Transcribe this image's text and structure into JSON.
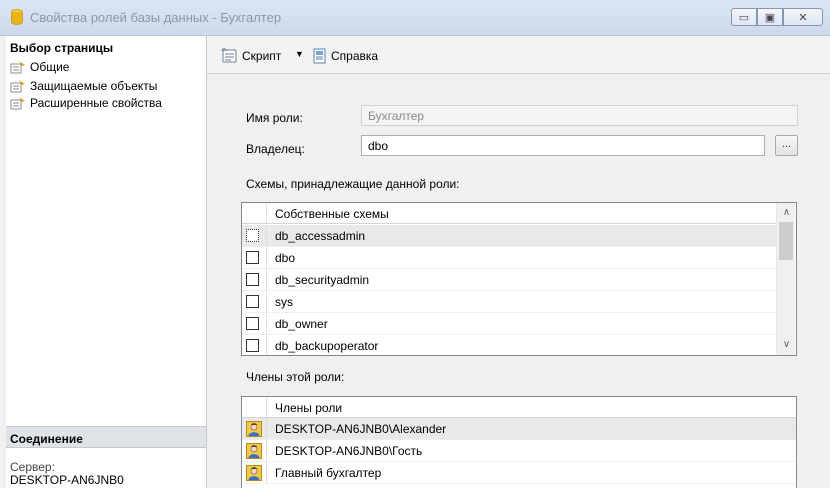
{
  "window": {
    "title": "Свойства ролей базы данных - Бухгалтер",
    "min_glyph": "▭",
    "max_glyph": "▣",
    "close_glyph": "✕"
  },
  "sidebar": {
    "heading": "Выбор страницы",
    "items": [
      {
        "label": "Общие"
      },
      {
        "label": "Защищаемые объекты"
      },
      {
        "label": "Расширенные свойства"
      }
    ],
    "connection_heading": "Соединение",
    "server_label": "Сервер:",
    "server_value": "DESKTOP-AN6JNB0"
  },
  "toolbar": {
    "script_label": "Скрипт",
    "script_arrow": "▼",
    "help_label": "Справка"
  },
  "form": {
    "role_name_label": "Имя роли:",
    "role_name_value": "Бухгалтер",
    "owner_label": "Владелец:",
    "owner_value": "dbo",
    "browse_label": "...",
    "schemas_label": "Схемы, принадлежащие данной роли:",
    "members_label": "Члены этой роли:"
  },
  "schemas_grid": {
    "header": "Собственные схемы",
    "rows": [
      {
        "name": "db_accessadmin",
        "checked": false,
        "selected": true
      },
      {
        "name": "dbo",
        "checked": false,
        "selected": false
      },
      {
        "name": "db_securityadmin",
        "checked": false,
        "selected": false
      },
      {
        "name": "sys",
        "checked": false,
        "selected": false
      },
      {
        "name": "db_owner",
        "checked": false,
        "selected": false
      },
      {
        "name": "db_backupoperator",
        "checked": false,
        "selected": false
      }
    ],
    "scroll_up": "∧",
    "scroll_down": "∨"
  },
  "members_grid": {
    "header": "Члены роли",
    "rows": [
      {
        "name": "DESKTOP-AN6JNB0\\Alexander",
        "selected": true
      },
      {
        "name": "DESKTOP-AN6JNB0\\Гость",
        "selected": false
      },
      {
        "name": "Главный бухгалтер",
        "selected": false
      }
    ]
  },
  "colors": {
    "selection": "#e9e9e9",
    "title_text": "#8a97a8",
    "icon_gold": "#e8b419"
  }
}
